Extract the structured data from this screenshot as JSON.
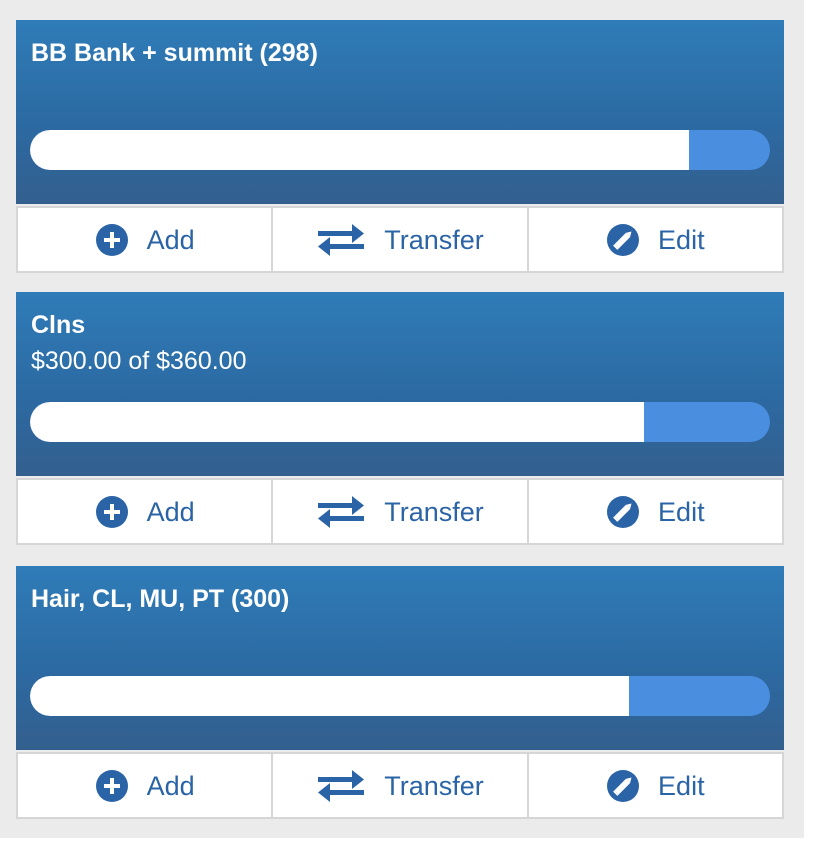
{
  "colors": {
    "header_top": "#2f7cb8",
    "header_bottom": "#335f8e",
    "progress_remaining": "#4a8ee0",
    "progress_fill": "#ffffff",
    "action_text": "#2b64a6",
    "page_background": "#ebebeb"
  },
  "envelopes": [
    {
      "title": "BB Bank + summit (298)",
      "subtitle": "",
      "progress_fraction": 0.89,
      "actions": {
        "add_label": "Add",
        "add_icon": "plus-circle-icon",
        "transfer_label": "Transfer",
        "transfer_icon": "transfer-arrows-icon",
        "edit_label": "Edit",
        "edit_icon": "pencil-circle-icon"
      }
    },
    {
      "title": "Clns",
      "subtitle": "$300.00 of $360.00",
      "progress_fraction": 0.83,
      "actions": {
        "add_label": "Add",
        "add_icon": "plus-circle-icon",
        "transfer_label": "Transfer",
        "transfer_icon": "transfer-arrows-icon",
        "edit_label": "Edit",
        "edit_icon": "pencil-circle-icon"
      }
    },
    {
      "title": "Hair, CL, MU, PT (300)",
      "subtitle": "",
      "progress_fraction": 0.81,
      "actions": {
        "add_label": "Add",
        "add_icon": "plus-circle-icon",
        "transfer_label": "Transfer",
        "transfer_icon": "transfer-arrows-icon",
        "edit_label": "Edit",
        "edit_icon": "pencil-circle-icon"
      }
    }
  ]
}
